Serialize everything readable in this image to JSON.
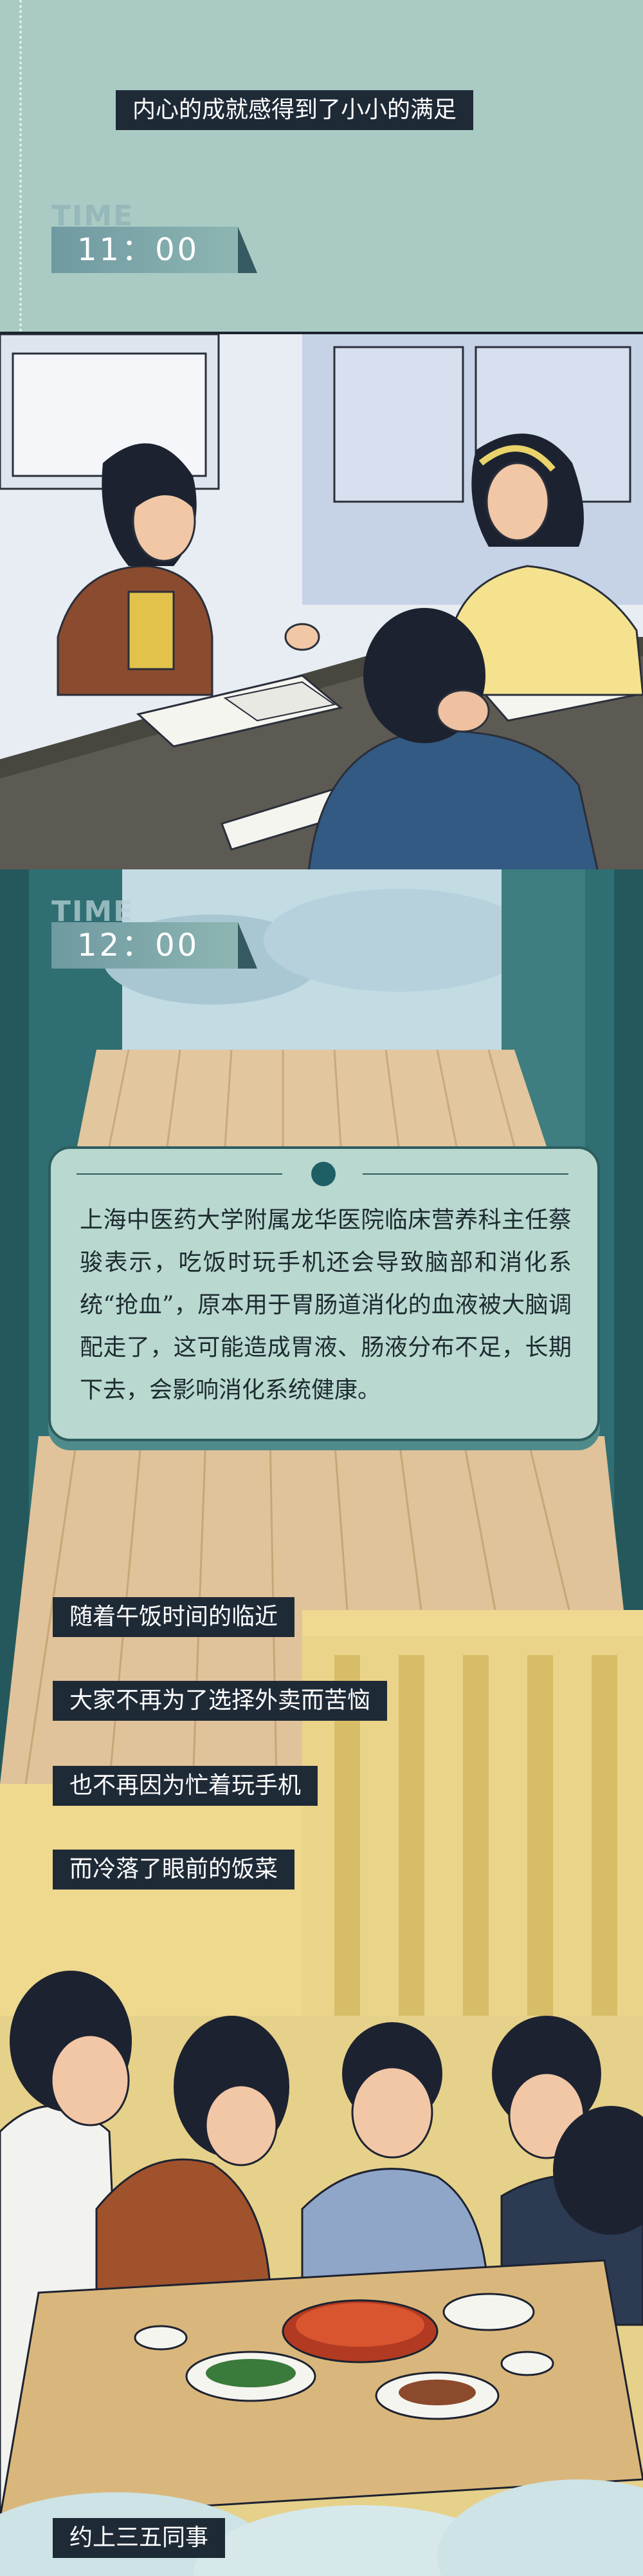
{
  "section1": {
    "caption": "内心的成就感得到了小小的满足",
    "time_label": "TIME",
    "time_value": "11：00"
  },
  "section3": {
    "time_label": "TIME",
    "time_value": "12：00",
    "info_text": "上海中医药大学附属龙华医院临床营养科主任蔡骏表示，吃饭时玩手机还会导致脑部和消化系统“抢血”，原本用于胃肠道消化的血液被大脑调配走了，这可能造成胃液、肠液分布不足，长期下去，会影响消化系统健康。",
    "captions": [
      "随着午饭时间的临近",
      "大家不再为了选择外卖而苦恼",
      "也不再因为忙着玩手机",
      "而冷落了眼前的饭菜",
      "约上三五同事"
    ]
  },
  "colors": {
    "teal_bg": "#a9cbc4",
    "caption_bg": "#1f2a37",
    "infobox_bg": "#b9d8d0",
    "dark_teal": "#2d5d5f"
  }
}
